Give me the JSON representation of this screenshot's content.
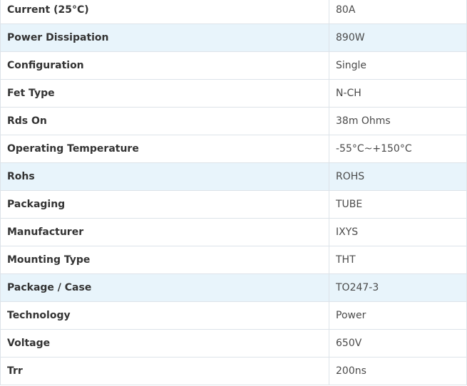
{
  "spec_table": {
    "rows": [
      {
        "label": "Current (25°C)",
        "value": "80A"
      },
      {
        "label": "Power Dissipation",
        "value": "890W"
      },
      {
        "label": "Configuration",
        "value": "Single"
      },
      {
        "label": "Fet Type",
        "value": "N-CH"
      },
      {
        "label": "Rds On",
        "value": "38m Ohms"
      },
      {
        "label": "Operating Temperature",
        "value": "-55°C~+150°C"
      },
      {
        "label": "Rohs",
        "value": "ROHS"
      },
      {
        "label": "Packaging",
        "value": "TUBE"
      },
      {
        "label": "Manufacturer",
        "value": "IXYS"
      },
      {
        "label": "Mounting Type",
        "value": "THT"
      },
      {
        "label": "Package / Case",
        "value": "TO247-3"
      },
      {
        "label": "Technology",
        "value": "Power"
      },
      {
        "label": "Voltage",
        "value": "650V"
      },
      {
        "label": "Trr",
        "value": "200ns"
      }
    ]
  },
  "colors": {
    "row_alt_background": "#e8f4fb",
    "border": "#dde3e9",
    "label_text": "#333333"
  }
}
